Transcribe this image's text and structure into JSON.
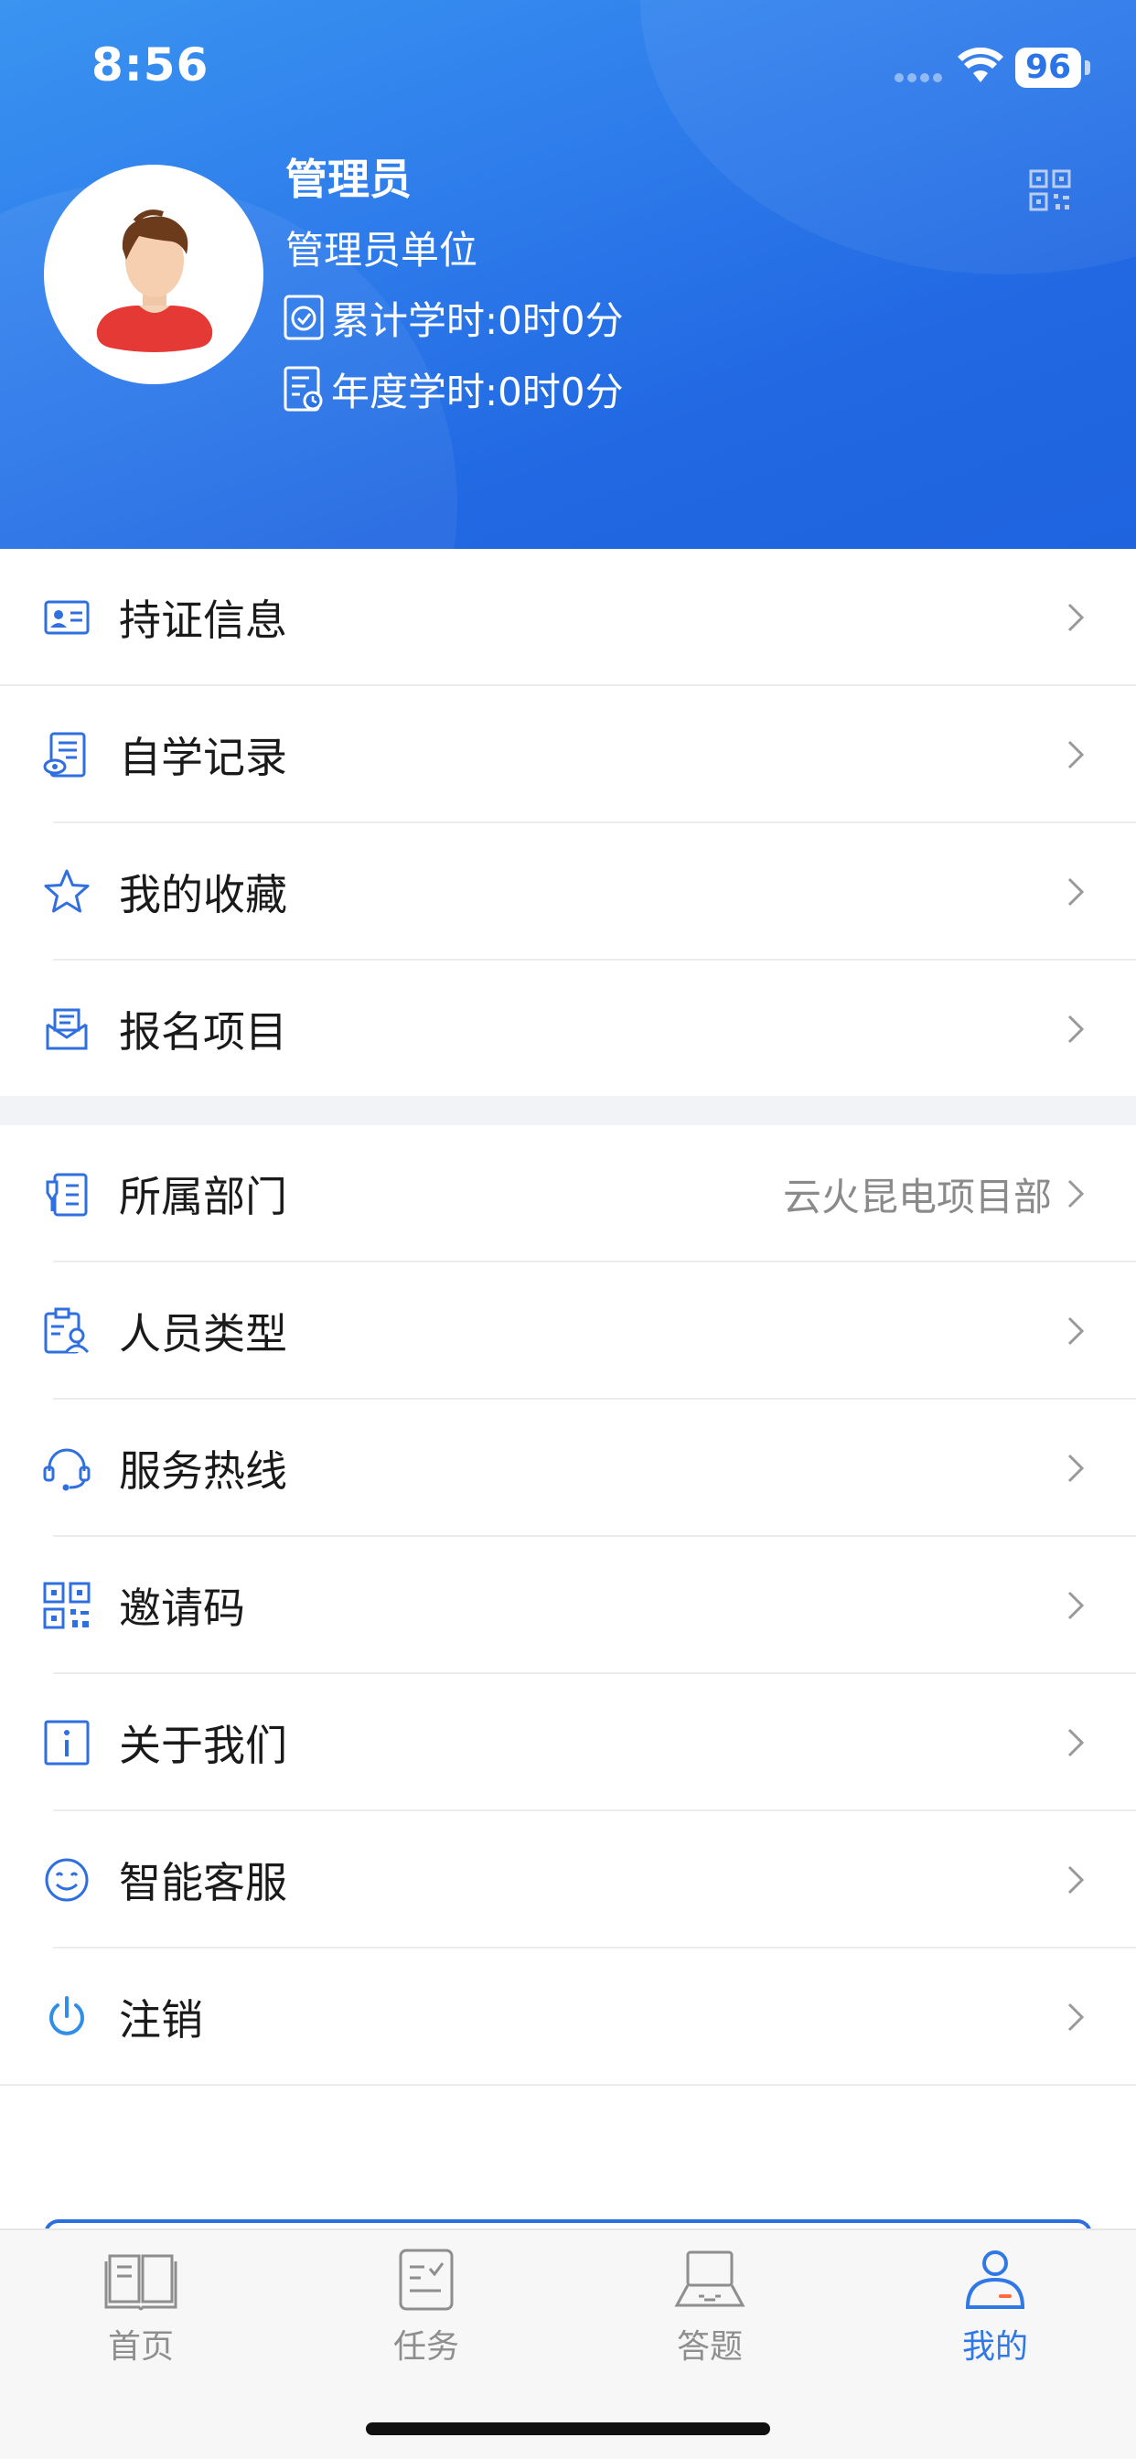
{
  "status_bar": {
    "time": "8:56",
    "battery": "96"
  },
  "profile": {
    "name": "管理员",
    "unit": "管理员单位",
    "total_hours": "累计学时:0时0分",
    "annual_hours": "年度学时:0时0分"
  },
  "menu_group1": [
    {
      "label": "持证信息",
      "icon": "id-card-icon"
    },
    {
      "label": "自学记录",
      "icon": "study-record-icon"
    },
    {
      "label": "我的收藏",
      "icon": "star-icon"
    },
    {
      "label": "报名项目",
      "icon": "enroll-icon"
    }
  ],
  "menu_group2": [
    {
      "label": "所属部门",
      "icon": "department-icon",
      "value": "云火昆电项目部"
    },
    {
      "label": "人员类型",
      "icon": "person-type-icon"
    },
    {
      "label": "服务热线",
      "icon": "headset-icon"
    },
    {
      "label": "邀请码",
      "icon": "qr-code-icon"
    },
    {
      "label": "关于我们",
      "icon": "info-icon"
    },
    {
      "label": "智能客服",
      "icon": "smile-icon"
    },
    {
      "label": "注销",
      "icon": "power-icon"
    }
  ],
  "tabs": [
    {
      "label": "首页",
      "icon": "book-icon"
    },
    {
      "label": "任务",
      "icon": "task-icon"
    },
    {
      "label": "答题",
      "icon": "laptop-icon"
    },
    {
      "label": "我的",
      "icon": "user-icon",
      "active": true
    }
  ],
  "colors": {
    "accent": "#2f78e6",
    "header_start": "#3a94f0",
    "header_end": "#1f63df"
  }
}
